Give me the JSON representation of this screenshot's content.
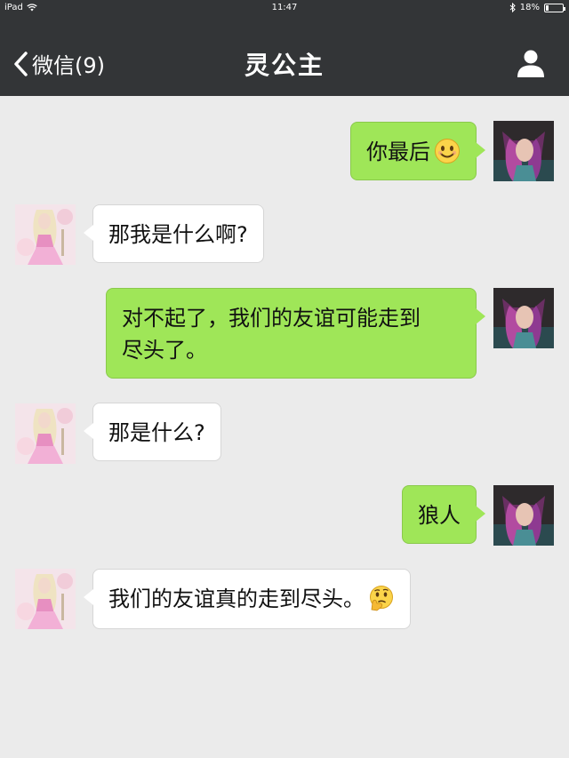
{
  "status_bar": {
    "carrier": "iPad",
    "time": "11:47",
    "battery_percent": "18%",
    "battery_level": 0.18
  },
  "nav": {
    "back_label": "微信(9)",
    "title": "灵公主"
  },
  "messages": [
    {
      "side": "out",
      "text": "你最后",
      "emoji": "smiling-face-emoji"
    },
    {
      "side": "in",
      "text": "那我是什么啊?"
    },
    {
      "side": "out",
      "line1": "对不起了，我们的友谊可能走到",
      "line2": "尽头了。"
    },
    {
      "side": "in",
      "text": "那是什么?"
    },
    {
      "side": "out",
      "text": "狼人"
    },
    {
      "side": "in",
      "text": "我们的友谊真的走到尽头。",
      "emoji": "thinking-face-emoji"
    }
  ],
  "colors": {
    "nav_bg": "#333537",
    "chat_bg": "#ebebeb",
    "outgoing_bubble": "#9fe658",
    "incoming_bubble": "#ffffff"
  }
}
